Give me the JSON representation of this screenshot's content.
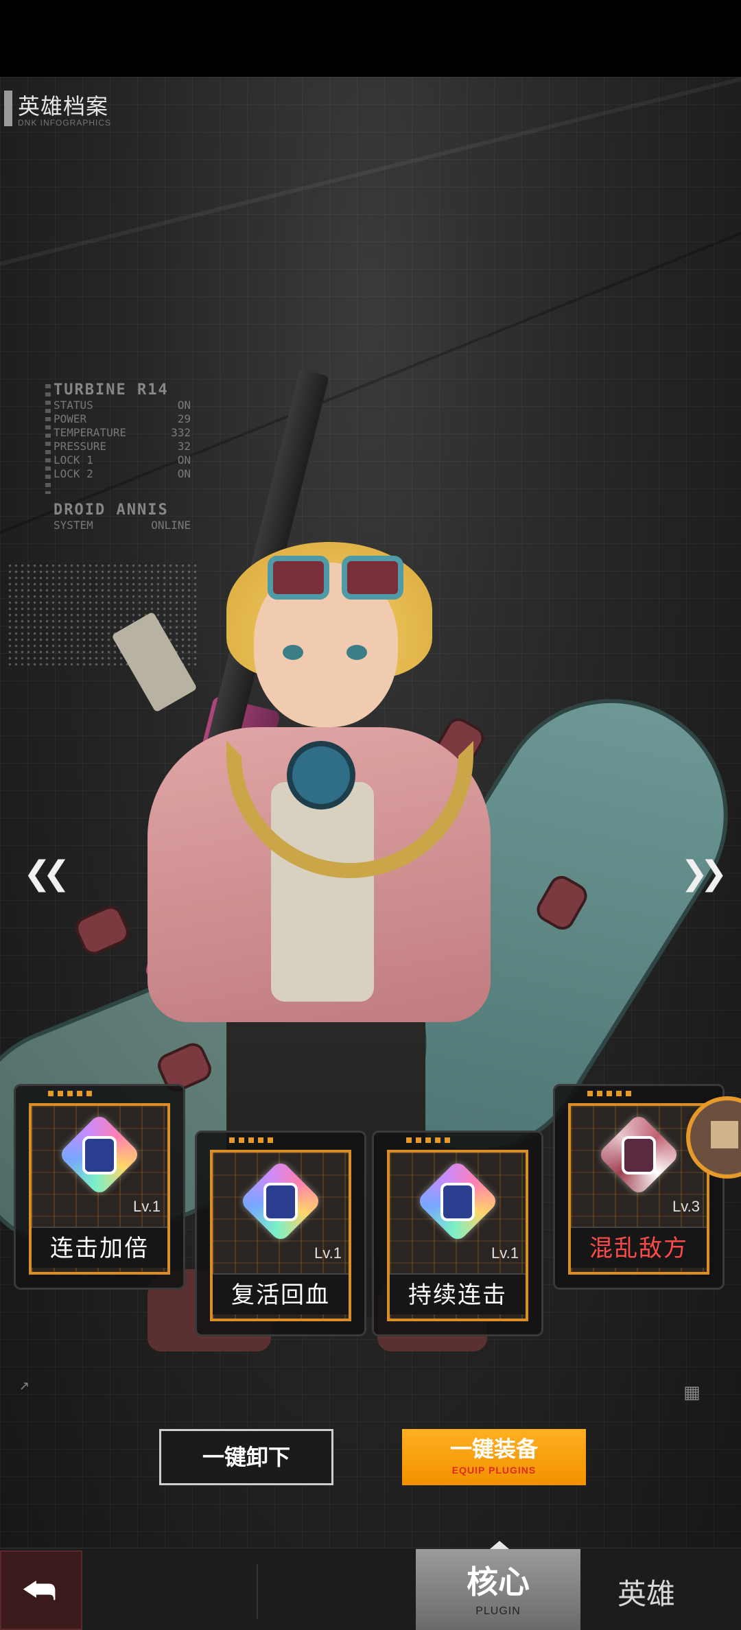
{
  "header": {
    "title": "英雄档案",
    "subtitle": "DNK INFOGRAPHICS"
  },
  "info_panel": {
    "heading1": "TURBINE R14",
    "rows1": [
      {
        "k": "STATUS",
        "v": "ON"
      },
      {
        "k": "POWER",
        "v": "29"
      },
      {
        "k": "TEMPERATURE",
        "v": "332"
      },
      {
        "k": "PRESSURE",
        "v": "32"
      },
      {
        "k": "LOCK 1",
        "v": "ON"
      },
      {
        "k": "LOCK 2",
        "v": "ON"
      }
    ],
    "heading2": "DROID ANNIS",
    "rows2": [
      {
        "k": "SYSTEM",
        "v": "ONLINE"
      }
    ]
  },
  "nav": {
    "prev_icon": "chevron-double-left-icon",
    "next_icon": "chevron-double-right-icon"
  },
  "plugins": [
    {
      "name": "连击加倍",
      "level": "Lv.1",
      "style": "rainbow"
    },
    {
      "name": "复活回血",
      "level": "Lv.1",
      "style": "rainbow"
    },
    {
      "name": "持续连击",
      "level": "Lv.1",
      "style": "rainbow"
    },
    {
      "name": "混乱敌方",
      "level": "Lv.3",
      "style": "red"
    }
  ],
  "actions": {
    "unequip_label": "一键卸下",
    "equip_label": "一键装备",
    "equip_sub": "EQUIP PLUGINS"
  },
  "bottom_nav": {
    "back_icon": "return-arrow-icon",
    "core_label": "核心",
    "core_sub": "PLUGIN",
    "hero_label": "英雄"
  },
  "colors": {
    "accent": "#F29100",
    "card_border": "#D98E28",
    "warning_text": "#FF4A4A"
  }
}
